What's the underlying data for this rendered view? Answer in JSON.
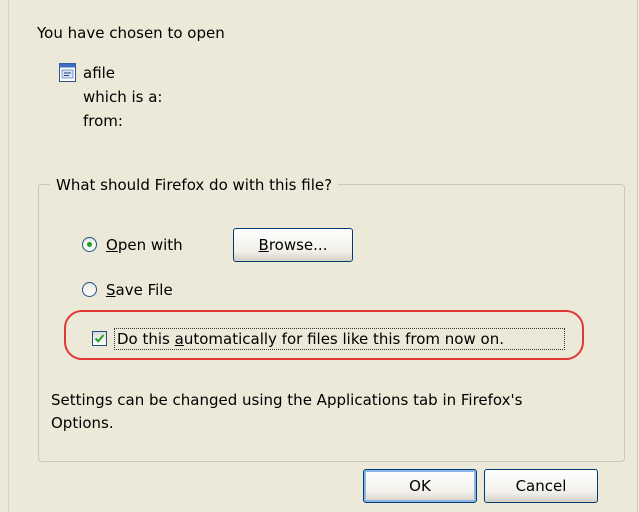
{
  "dialog": {
    "heading": "You have chosen to open",
    "file": {
      "icon": "document-icon",
      "name": "afile",
      "type_label": "which is a:",
      "from_label": "from:"
    },
    "group": {
      "legend": "What should Firefox do with this file?",
      "open_with": {
        "prefix": "",
        "accel": "O",
        "rest": "pen with",
        "selected": true
      },
      "browse_button": {
        "accel": "B",
        "rest": "rowse..."
      },
      "save_file": {
        "accel": "S",
        "rest": "ave File",
        "selected": false
      },
      "auto_checkbox": {
        "prefix": "Do this ",
        "accel": "a",
        "rest": "utomatically for files like this from now on.",
        "checked": true
      },
      "settings_note_line1": "Settings can be changed using the Applications tab in Firefox's",
      "settings_note_line2": "Options."
    },
    "buttons": {
      "ok": "OK",
      "cancel": "Cancel"
    },
    "colors": {
      "background": "#ece9d8",
      "highlight": "#e23737",
      "check": "#21a121"
    }
  }
}
